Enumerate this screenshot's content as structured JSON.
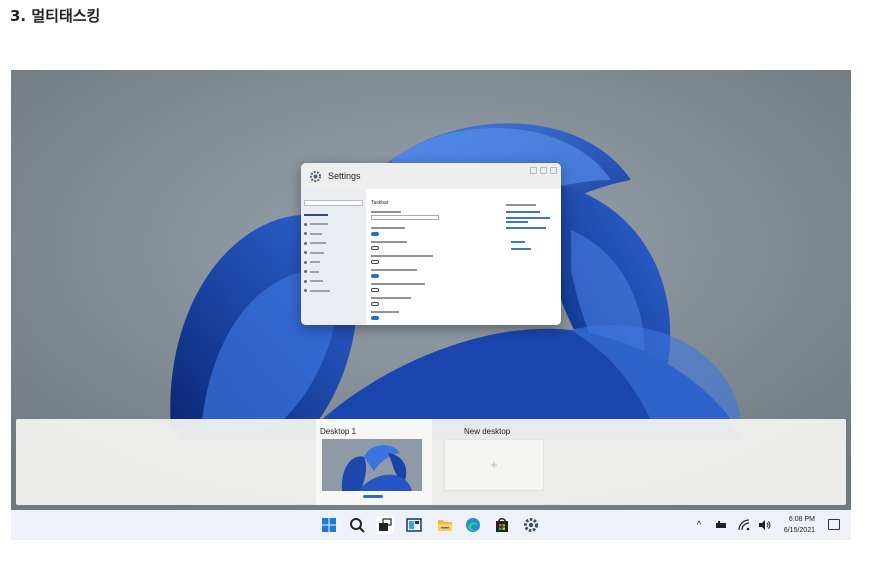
{
  "page": {
    "heading": "3. 멀티태스킹"
  },
  "settings_window": {
    "title": "Settings",
    "section_title": "Taskbar"
  },
  "taskview": {
    "desktops": [
      {
        "label": "Desktop 1",
        "selected": true
      },
      {
        "label": "New desktop",
        "add_symbol": "+"
      }
    ]
  },
  "taskbar": {
    "icons": [
      "start-icon",
      "search-icon",
      "task-view-icon",
      "widgets-icon",
      "file-explorer-icon",
      "edge-icon",
      "store-icon",
      "settings-icon"
    ],
    "tray": {
      "chevron": "^"
    },
    "clock": {
      "time": "6:08 PM",
      "date": "6/15/2021"
    }
  },
  "colors": {
    "accent": "#2a6cc6",
    "wallpaper": "#1e4fb5",
    "taskbar": "#eef1f7"
  }
}
